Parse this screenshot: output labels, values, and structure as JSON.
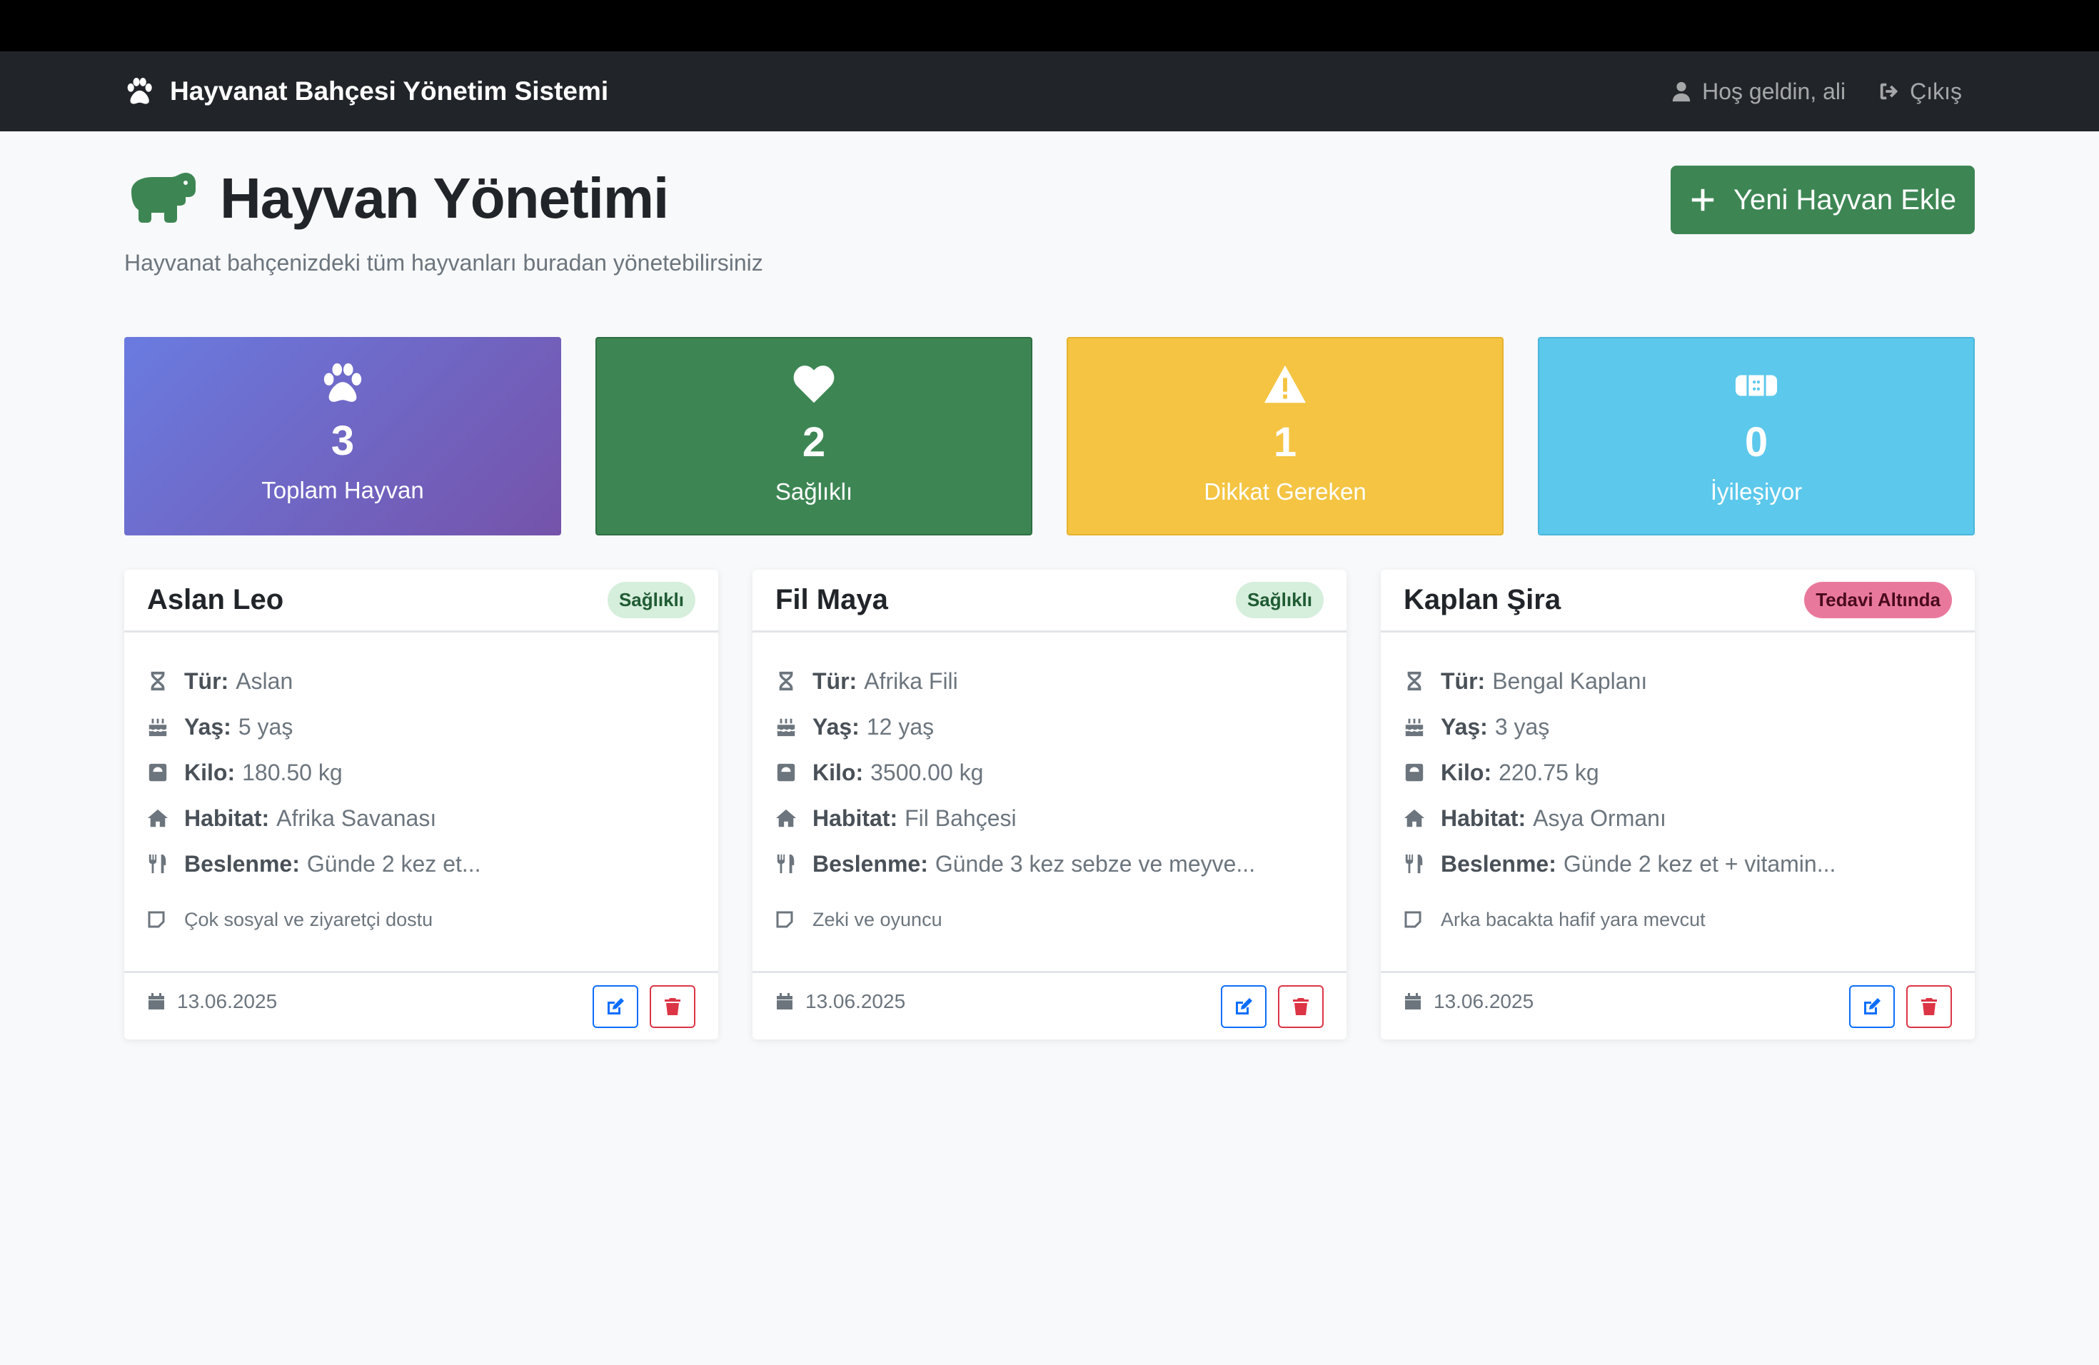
{
  "navbar": {
    "brand": "Hayvanat Bahçesi Yönetim Sistemi",
    "welcome": "Hoş geldin, ali",
    "logout": "Çıkış"
  },
  "header": {
    "title": "Hayvan Yönetimi",
    "subtitle": "Hayvanat bahçenizdeki tüm hayvanları buradan yönetebilirsiniz",
    "add_button": "Yeni Hayvan Ekle"
  },
  "stats": [
    {
      "value": "3",
      "label": "Toplam Hayvan",
      "icon": "paw-icon"
    },
    {
      "value": "2",
      "label": "Sağlıklı",
      "icon": "heart-icon"
    },
    {
      "value": "1",
      "label": "Dikkat Gereken",
      "icon": "warning-icon"
    },
    {
      "value": "0",
      "label": "İyileşiyor",
      "icon": "bandage-icon"
    }
  ],
  "labels": {
    "species": "Tür:",
    "age": "Yaş:",
    "weight": "Kilo:",
    "habitat": "Habitat:",
    "diet": "Beslenme:"
  },
  "animals": [
    {
      "name": "Aslan Leo",
      "status": "Sağlıklı",
      "status_color": "#d6eedc",
      "species": "Aslan",
      "age": "5 yaş",
      "weight": "180.50 kg",
      "habitat": "Afrika Savanası",
      "diet": "Günde 2 kez et...",
      "note": "Çok sosyal ve ziyaretçi dostu",
      "date": "13.06.2025"
    },
    {
      "name": "Fil Maya",
      "status": "Sağlıklı",
      "status_color": "#d6eedc",
      "species": "Afrika Fili",
      "age": "12 yaş",
      "weight": "3500.00 kg",
      "habitat": "Fil Bahçesi",
      "diet": "Günde 3 kez sebze ve meyve...",
      "note": "Zeki ve oyuncu",
      "date": "13.06.2025"
    },
    {
      "name": "Kaplan Şira",
      "status": "Tedavi Altında",
      "status_color": "#e9799c",
      "species": "Bengal Kaplanı",
      "age": "3 yaş",
      "weight": "220.75 kg",
      "habitat": "Asya Ormanı",
      "diet": "Günde 2 kez et + vitamin...",
      "note": "Arka bacakta hafif yara mevcut",
      "date": "13.06.2025"
    }
  ],
  "colors": {
    "primary_green": "#3d8654",
    "warning": "#f4c442",
    "info": "#5cc8ec",
    "gradient_start": "#6a7be0",
    "gradient_end": "#7553aa"
  }
}
